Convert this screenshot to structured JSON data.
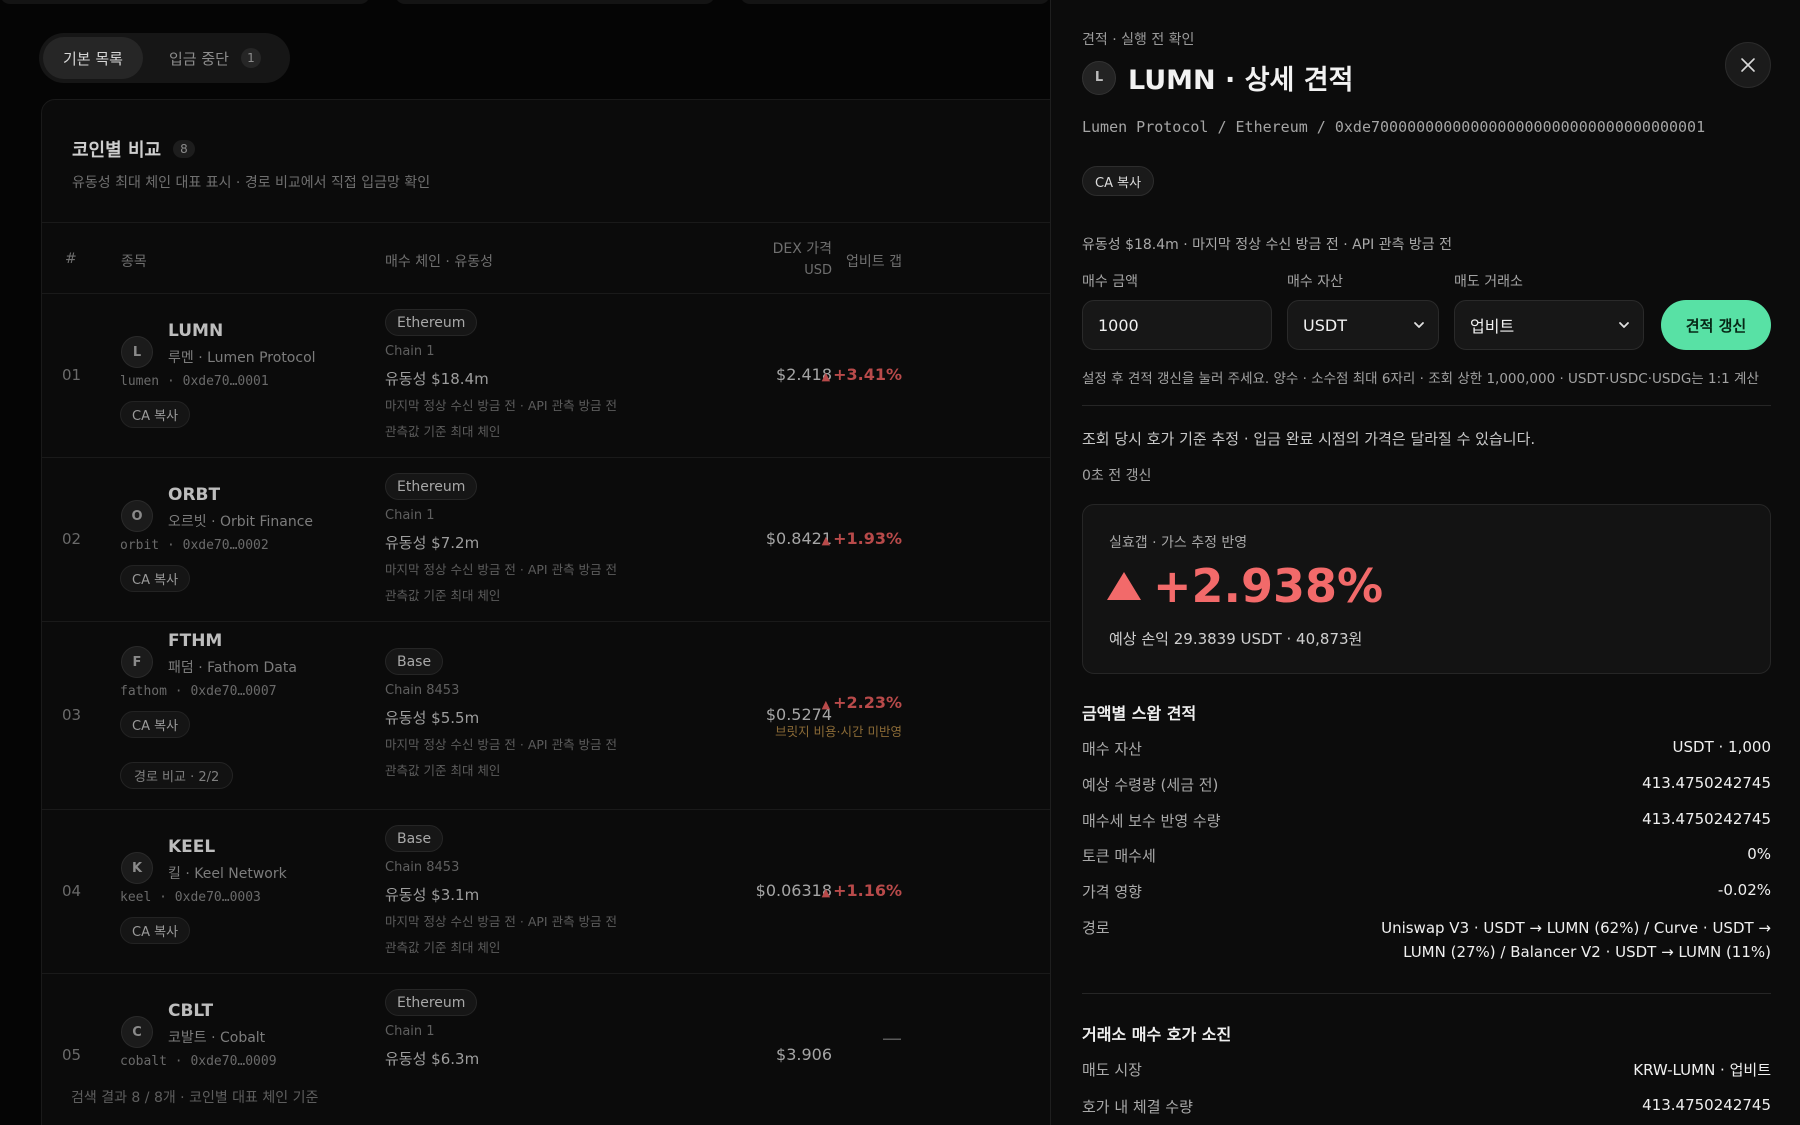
{
  "tabs": [
    {
      "label": "기본 목록"
    },
    {
      "label": "입금 중단",
      "count": "1"
    }
  ],
  "table": {
    "title": "코인별 비교",
    "count": "8",
    "subtitle": "유동성 최대 체인 대표 표시 · 경로 비교에서 직접 입금망 확인",
    "headers": {
      "num": "#",
      "asset": "종목",
      "chain": "매수 체인 · 유동성",
      "price": "DEX 가격",
      "price_unit": "USD",
      "gap": "업비트 갭"
    },
    "rows": [
      {
        "num": "01",
        "letter": "L",
        "ticker": "LUMN",
        "names": "루멘 · Lumen Protocol",
        "slug": "lumen · 0xde70…0001",
        "ca": "CA 복사",
        "chain": "Ethereum",
        "chain_id": "Chain 1",
        "liquidity": "유동성 $18.4m",
        "note1": "마지막 정상 수신 방금 전 · API 관측 방금 전",
        "note2": "관측값 기준 최대 체인",
        "price": "$2.418",
        "gap": "+3.41%"
      },
      {
        "num": "02",
        "letter": "O",
        "ticker": "ORBT",
        "names": "오르빗 · Orbit Finance",
        "slug": "orbit · 0xde70…0002",
        "ca": "CA 복사",
        "chain": "Ethereum",
        "chain_id": "Chain 1",
        "liquidity": "유동성 $7.2m",
        "note1": "마지막 정상 수신 방금 전 · API 관측 방금 전",
        "note2": "관측값 기준 최대 체인",
        "price": "$0.8421",
        "gap": "+1.93%"
      },
      {
        "num": "03",
        "letter": "F",
        "ticker": "FTHM",
        "names": "패덤 · Fathom Data",
        "slug": "fathom · 0xde70…0007",
        "ca": "CA 복사",
        "route": "경로 비교 · 2/2",
        "chain": "Base",
        "chain_id": "Chain 8453",
        "liquidity": "유동성 $5.5m",
        "note1": "마지막 정상 수신 방금 전 · API 관측 방금 전",
        "note2": "관측값 기준 최대 체인",
        "price": "$0.5274",
        "gap": "+2.23%",
        "gap_note": "브릿지 비용·시간 미반영"
      },
      {
        "num": "04",
        "letter": "K",
        "ticker": "KEEL",
        "names": "킬 · Keel Network",
        "slug": "keel · 0xde70…0003",
        "ca": "CA 복사",
        "chain": "Base",
        "chain_id": "Chain 8453",
        "liquidity": "유동성 $3.1m",
        "note1": "마지막 정상 수신 방금 전 · API 관측 방금 전",
        "note2": "관측값 기준 최대 체인",
        "price": "$0.06318",
        "gap": "+1.16%"
      },
      {
        "num": "05",
        "letter": "C",
        "ticker": "CBLT",
        "names": "코발트 · Cobalt",
        "slug": "cobalt · 0xde70…0009",
        "chain": "Ethereum",
        "chain_id": "Chain 1",
        "liquidity": "유동성 $6.3m",
        "price": "$3.906",
        "gap": "—"
      }
    ],
    "footer": "검색 결과 8 / 8개 · 코인별 대표 체인 기준"
  },
  "drawer": {
    "eyebrow": "견적 · 실행 전 확인",
    "avatar_letter": "L",
    "title": "LUMN · 상세 견적",
    "path": "Lumen Protocol / Ethereum / 0xde7000000000000000000000000000000000001",
    "ca_copy": "CA 복사",
    "liquidity_line": "유동성 $18.4m · 마지막 정상 수신 방금 전 · API 관측 방금 전",
    "form": {
      "amount_label": "매수 금액",
      "amount_value": "1000",
      "asset_label": "매수 자산",
      "asset_value": "USDT",
      "exchange_label": "매도 거래소",
      "exchange_value": "업비트",
      "refresh_label": "견적 갱신"
    },
    "help": "설정 후 견적 갱신을 눌러 주세요. 양수 · 소수점 최대 6자리 · 조회 상한 1,000,000 · USDT·USDC·USDG는 1:1 계산",
    "estimate_note": "조회 당시 호가 기준 추정 · 입금 완료 시점의 가격은 달라질 수 있습니다.",
    "updated": "0초 전 갱신",
    "result": {
      "label": "실효갭 · 가스 추정 반영",
      "value": "+2.938%",
      "sub": "예상 손익 29.3839 USDT · 40,873원"
    },
    "swap": {
      "title": "금액별 스왑 견적",
      "rows": [
        {
          "k": "매수 자산",
          "v": "USDT · 1,000"
        },
        {
          "k": "예상 수령량 (세금 전)",
          "v": "413.4750242745"
        },
        {
          "k": "매수세 보수 반영 수량",
          "v": "413.4750242745"
        },
        {
          "k": "토큰 매수세",
          "v": "0%"
        },
        {
          "k": "가격 영향",
          "v": "-0.02%"
        }
      ],
      "route_label": "경로",
      "route_value": "Uniswap V3 · USDT → LUMN (62%) / Curve · USDT → LUMN (27%) / Balancer V2 · USDT → LUMN (11%)"
    },
    "book": {
      "title": "거래소 매수 호가 소진",
      "rows": [
        {
          "k": "매도 시장",
          "v": "KRW-LUMN · 업비트"
        },
        {
          "k": "호가 내 체결 수량",
          "v": "413.4750242745"
        }
      ]
    }
  },
  "colors": {
    "accent": "#58e1a5",
    "gain": "#f26a6a",
    "warning": "#8a6a36"
  },
  "icons": {
    "close": "close-icon",
    "chevron": "chevron-down-icon",
    "gain": "triangle-up-icon"
  }
}
